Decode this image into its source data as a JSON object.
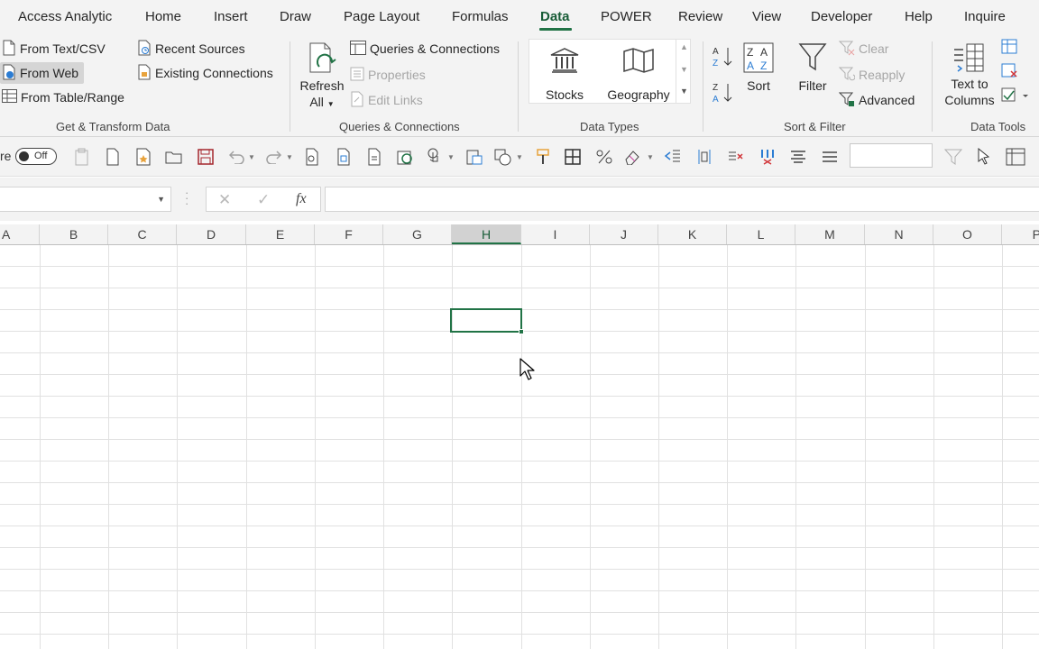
{
  "tabs": [
    {
      "label": "Access Analytic"
    },
    {
      "label": "Home"
    },
    {
      "label": "Insert"
    },
    {
      "label": "Draw"
    },
    {
      "label": "Page Layout"
    },
    {
      "label": "Formulas"
    },
    {
      "label": "Data"
    },
    {
      "label": "POWER"
    },
    {
      "label": "Review"
    },
    {
      "label": "View"
    },
    {
      "label": "Developer"
    },
    {
      "label": "Help"
    },
    {
      "label": "Inquire"
    }
  ],
  "active_tab": "Data",
  "ribbon": {
    "get_transform": {
      "from_text_csv": "From Text/CSV",
      "from_web": "From Web",
      "from_table_range": "From Table/Range",
      "recent_sources": "Recent Sources",
      "existing_connections": "Existing Connections",
      "group_label": "Get & Transform Data"
    },
    "queries": {
      "refresh_line1": "Refresh",
      "refresh_line2": "All",
      "queries_connections": "Queries & Connections",
      "properties": "Properties",
      "edit_links": "Edit Links",
      "group_label": "Queries & Connections"
    },
    "data_types": {
      "stocks": "Stocks",
      "geography": "Geography",
      "group_label": "Data Types"
    },
    "sort_filter": {
      "sort": "Sort",
      "filter": "Filter",
      "clear": "Clear",
      "reapply": "Reapply",
      "advanced": "Advanced",
      "group_label": "Sort & Filter"
    },
    "data_tools": {
      "text_to_columns_line1": "Text to",
      "text_to_columns_line2": "Columns",
      "group_label": "Data Tools"
    }
  },
  "qat": {
    "autosave_fragment": "re",
    "toggle_state": "Off"
  },
  "formula_bar": {
    "name_box": "",
    "cancel_symbol": "✕",
    "enter_symbol": "✓",
    "fx_label": "fx",
    "content": ""
  },
  "grid": {
    "columns": [
      "A",
      "B",
      "C",
      "D",
      "E",
      "F",
      "G",
      "H",
      "I",
      "J",
      "K",
      "L",
      "M",
      "N",
      "O",
      "P"
    ],
    "selected_column": "H",
    "active_cell": "H4"
  },
  "colors": {
    "accent": "#217346",
    "ribbon_bg": "#f3f3f3",
    "gridline": "#e1e1e1"
  }
}
